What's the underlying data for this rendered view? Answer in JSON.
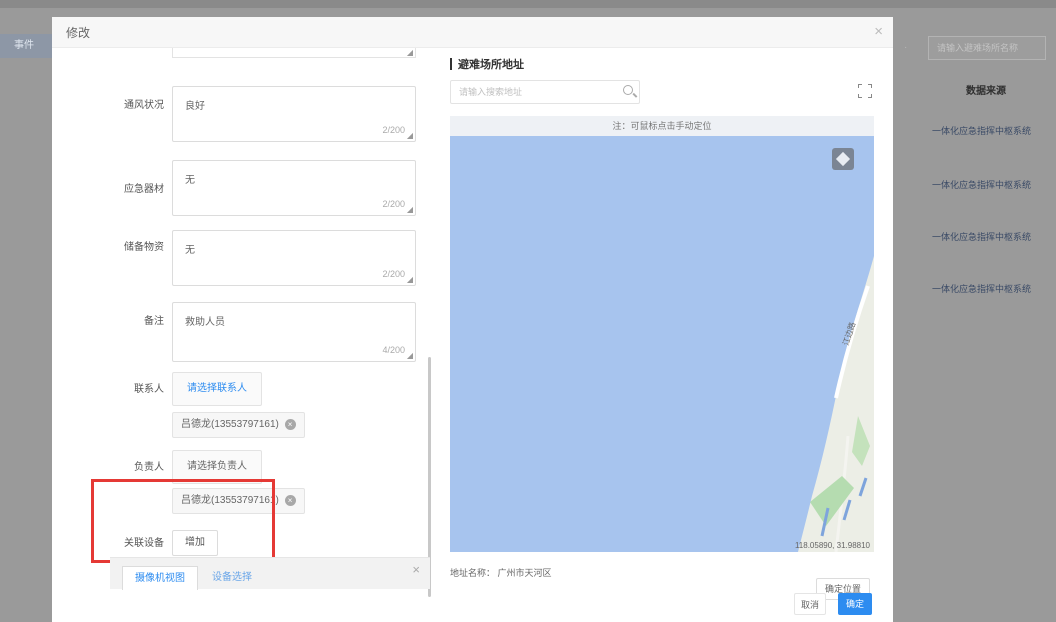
{
  "background": {
    "left_tab": "事件",
    "right_search_placeholder": "请输入避难场所名称",
    "right_sep": "·",
    "column_header": "数据来源",
    "rows": [
      "一体化应急指挥中枢系统",
      "一体化应急指挥中枢系统",
      "一体化应急指挥中枢系统",
      "一体化应急指挥中枢系统"
    ]
  },
  "modal": {
    "title": "修改",
    "close_glyph": "×"
  },
  "form": {
    "ventilation": {
      "label": "通风状况",
      "value": "良好",
      "count": "2/200"
    },
    "supplies": {
      "label": "应急器材",
      "value": "无",
      "count": "2/200"
    },
    "reserves": {
      "label": "储备物资",
      "value": "无",
      "count": "2/200"
    },
    "remark": {
      "label": "备注",
      "value": "救助人员",
      "count": "4/200"
    },
    "contact": {
      "label": "联系人",
      "button": "请选择联系人",
      "tag": "吕德龙(13553797161)"
    },
    "manager": {
      "label": "负责人",
      "button": "请选择负责人",
      "tag": "吕德龙(13553797161)"
    },
    "devices": {
      "label": "关联设备",
      "button": "增加"
    },
    "sub_panel": {
      "tab_active": "摄像机视图",
      "tab_other": "设备选择"
    }
  },
  "map": {
    "heading": "避难场所地址",
    "search_placeholder": "请输入搜索地址",
    "note": "注：可鼠标点击手动定位",
    "road_label": "江边路",
    "coords": "118.05890, 31.98810",
    "address_label": "地址名称：",
    "address_value": "广州市天河区",
    "confirm_location": "确定位置"
  },
  "footer": {
    "cancel": "取消",
    "ok": "确定"
  },
  "colors": {
    "accent": "#2d8cf0",
    "highlight": "#e53935",
    "water": "#a7c4ee"
  }
}
